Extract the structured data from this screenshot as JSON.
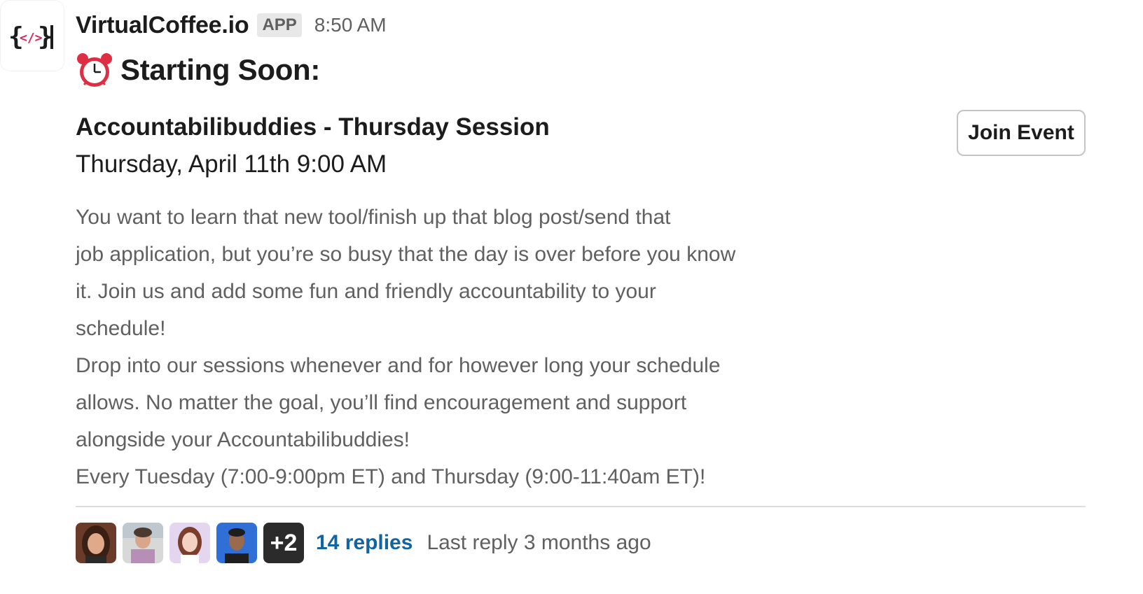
{
  "sender": {
    "name": "VirtualCoffee.io",
    "badge": "APP",
    "time": "8:50 AM",
    "avatar_icon": "code-brackets-logo-icon"
  },
  "headline": {
    "icon": "alarm-clock-icon",
    "text": "Starting Soon:"
  },
  "event": {
    "title": "Accountabilibuddies - Thursday Session",
    "date": "Thursday, April 11th 9:00 AM",
    "join_label": "Join Event"
  },
  "description_lines": [
    "You want to learn that new tool/finish up that blog post/send that",
    "job application, but you’re so busy that the day is over before you know",
    "it. Join us and add some fun and friendly accountability to your",
    "schedule!",
    "Drop into our sessions whenever and for however long your schedule",
    "allows. No matter the goal, you’ll find encouragement and support",
    "alongside your Accountabilibuddies!",
    "Every Tuesday (7:00-9:00pm ET) and Thursday (9:00-11:40am ET)!"
  ],
  "thread": {
    "more_count": "+2",
    "replies_label": "14 replies",
    "last_reply": "Last reply 3 months ago"
  },
  "colors": {
    "link": "#1264a3",
    "muted": "#616061",
    "text": "#1d1c1d",
    "logo_accent": "#e01e5a"
  }
}
